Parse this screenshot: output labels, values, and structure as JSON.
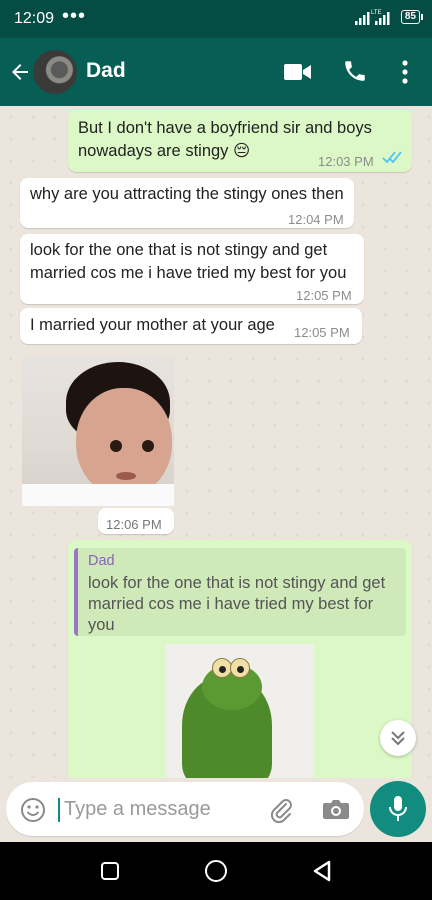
{
  "status_bar": {
    "time": "12:09",
    "dots": "•••",
    "network": "LTE",
    "battery": "85"
  },
  "header": {
    "contact_name": "Dad",
    "back_icon": "arrow-left-icon",
    "video_icon": "video-call-icon",
    "call_icon": "phone-icon",
    "menu_icon": "more-vert-icon",
    "bg_color": "#075e54"
  },
  "messages": [
    {
      "direction": "out",
      "text_line1": "But I don't have a boyfriend sir and boys",
      "text_line2": "nowadays are stingy 😔",
      "time": "12:03 PM",
      "read": true
    },
    {
      "direction": "in",
      "text": "why are you attracting the stingy ones then",
      "time": "12:04 PM"
    },
    {
      "direction": "in",
      "text_line1": "look for the one that is not stingy and get",
      "text_line2": "married cos me i have tried my best for you",
      "time": "12:05 PM"
    },
    {
      "direction": "in",
      "text": "I married your mother at your age",
      "time": "12:05 PM"
    },
    {
      "direction": "in",
      "type": "image",
      "image": "child-photo",
      "time": "12:06 PM"
    },
    {
      "direction": "out",
      "type": "reply-image",
      "quoted_sender": "Dad",
      "quoted_line1": "look for the one that is not stingy and get",
      "quoted_line2": "married cos me i have tried my best for",
      "quoted_line3": "you",
      "image": "kermit-photo"
    }
  ],
  "input": {
    "placeholder": "Type a message",
    "emoji_icon": "emoji-icon",
    "attach_icon": "paperclip-icon",
    "camera_icon": "camera-icon",
    "mic_icon": "microphone-icon"
  },
  "colors": {
    "accent": "#128c7e",
    "outgoing_bubble": "#dcf8c6",
    "incoming_bubble": "#ffffff",
    "read_ticks": "#4fc3f7"
  }
}
